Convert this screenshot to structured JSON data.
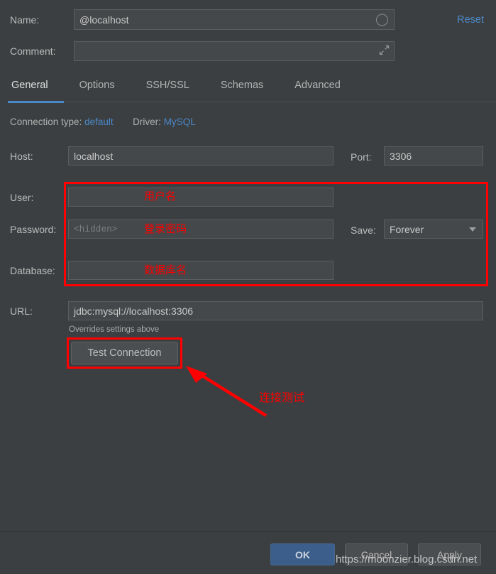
{
  "header": {
    "name_label": "Name:",
    "name_value": "@localhost",
    "name_icon": "circle-icon",
    "comment_label": "Comment:",
    "comment_value": "",
    "comment_icon": "expand-diagonal-icon",
    "reset_label": "Reset"
  },
  "tabs": [
    {
      "label": "General",
      "active": true
    },
    {
      "label": "Options",
      "active": false
    },
    {
      "label": "SSH/SSL",
      "active": false
    },
    {
      "label": "Schemas",
      "active": false
    },
    {
      "label": "Advanced",
      "active": false
    }
  ],
  "connection_info": {
    "type_label": "Connection type:",
    "type_value": "default",
    "driver_label": "Driver:",
    "driver_value": "MySQL"
  },
  "form": {
    "host_label": "Host:",
    "host_value": "localhost",
    "port_label": "Port:",
    "port_value": "3306",
    "user_label": "User:",
    "user_value": "",
    "password_label": "Password:",
    "password_placeholder": "<hidden>",
    "save_label": "Save:",
    "save_value": "Forever",
    "save_icon": "chevron-down-icon",
    "database_label": "Database:",
    "database_value": "",
    "url_label": "URL:",
    "url_value": "jdbc:mysql://localhost:3306",
    "overrides_note": "Overrides settings above",
    "test_connection_label": "Test Connection"
  },
  "annotations": {
    "user": "用户名",
    "password": "登录密码",
    "database": "数据库名",
    "test_connection": "连接测试",
    "color": "#fe0000"
  },
  "footer": {
    "ok_label": "OK",
    "cancel_label": "Cancel",
    "apply_label": "Apply"
  },
  "watermark": "https://moonzier.blog.csdn.net",
  "colors": {
    "background": "#3c3f41",
    "field_background": "#45484a",
    "accent_blue": "#4a88c7",
    "ok_button": "#3c5e8a",
    "annotation_red": "#fe0000"
  }
}
